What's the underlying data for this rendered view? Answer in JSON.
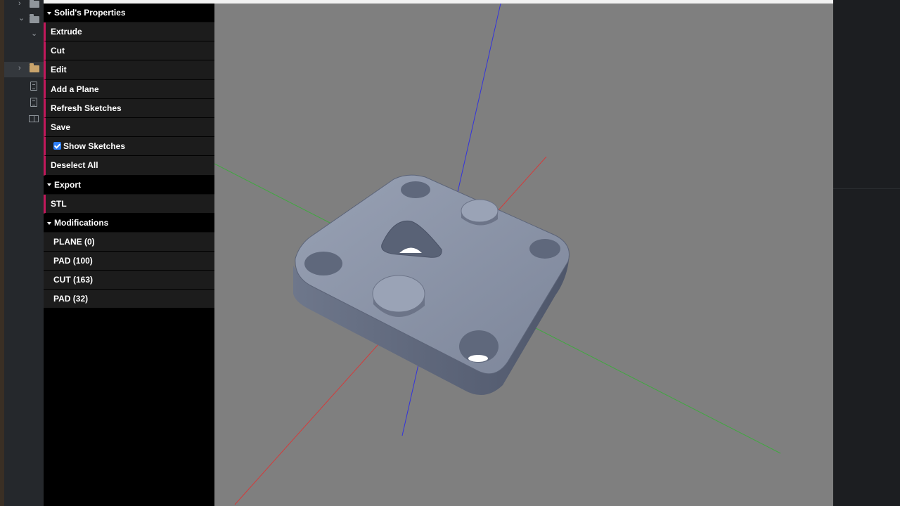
{
  "panel": {
    "sections": [
      {
        "title": "Solid's Properties"
      },
      {
        "title": "Export"
      },
      {
        "title": "Modifications"
      }
    ],
    "properties": [
      "Extrude",
      "Cut",
      "Edit",
      "Add a Plane",
      "Refresh Sketches",
      "Save"
    ],
    "show_sketches": {
      "label": "Show Sketches",
      "checked": true
    },
    "deselect_all": "Deselect All",
    "export_items": [
      "STL"
    ],
    "modifications": [
      "PLANE (0)",
      "PAD (100)",
      "CUT (163)",
      "PAD (32)"
    ]
  },
  "tree": {
    "icons": [
      "folder-icon",
      "folder-icon",
      "folder-icon",
      "document-icon",
      "document-icon",
      "book-icon"
    ]
  },
  "colors": {
    "accent": "#c2185b",
    "checkbox": "#2d7ef7",
    "viewport_bg": "#7f7f7f",
    "model": "#8a93a6",
    "axis_x": "#d43b3b",
    "axis_y": "#3fa93f",
    "axis_z": "#3333dd"
  }
}
